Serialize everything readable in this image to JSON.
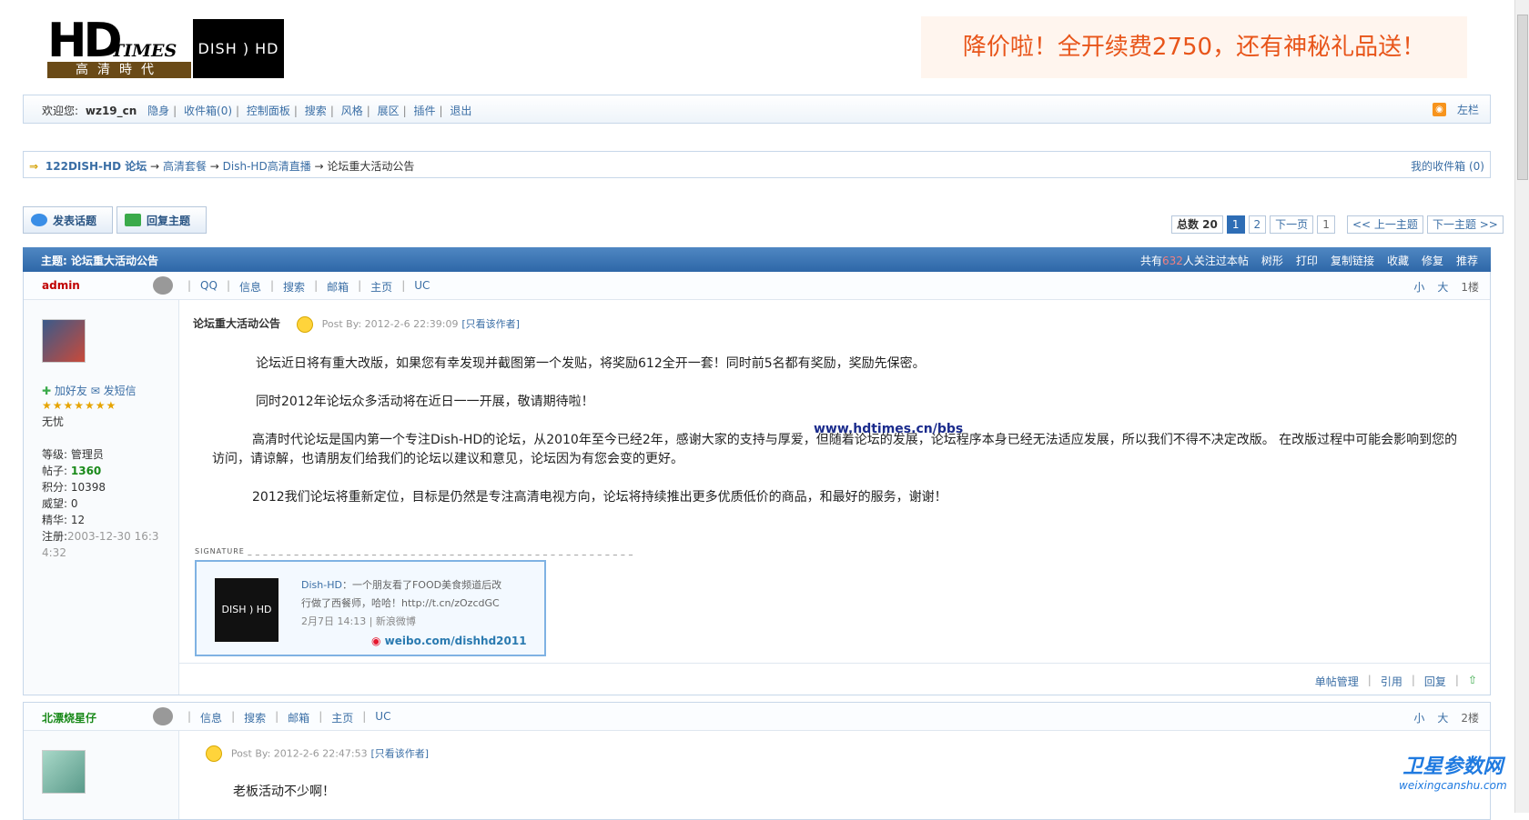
{
  "header": {
    "logo_hd": "HD",
    "logo_times": "TIMES",
    "logo_cn": "高清時代",
    "logo_dish": "DISH ) HD",
    "promo": "降价啦！全开续费2750，还有神秘礼品送！"
  },
  "userbar": {
    "welcome": "欢迎您:",
    "username": "wz19_cn",
    "links": [
      "隐身",
      "收件箱(0)",
      "控制面板",
      "搜索",
      "风格",
      "展区",
      "插件",
      "退出"
    ],
    "right_label": "左栏"
  },
  "breadcrumb": {
    "items": [
      "122DISH-HD 论坛",
      "高清套餐",
      "Dish-HD高清直播",
      "论坛重大活动公告"
    ],
    "separator": "→",
    "right": "我的收件箱 (0)"
  },
  "actions": {
    "new_topic": "发表话题",
    "reply": "回复主题"
  },
  "pager": {
    "total": "总数 20",
    "pages": [
      "1",
      "2"
    ],
    "next": "下一页",
    "jump": "1",
    "prev_topic": "<< 上一主题",
    "next_topic": "下一主题 >>"
  },
  "thread": {
    "title_label": "主题: 论坛重大活动公告",
    "watchers_prefix": "共有",
    "watchers_count": "632",
    "watchers_suffix": "人关注过本帖",
    "tools": [
      "树形",
      "打印",
      "复制链接",
      "收藏",
      "修复",
      "推荐"
    ]
  },
  "post1": {
    "author": "admin",
    "links": [
      "QQ",
      "信息",
      "搜索",
      "邮箱",
      "主页",
      "UC"
    ],
    "font_small": "小",
    "font_big": "大",
    "floor": "1楼",
    "add_friend": "加好友",
    "send_msg": "发短信",
    "stars": "★★★★★★★",
    "status": "无忧",
    "info": {
      "level": "等级: 管理员",
      "posts_label": "帖子:",
      "posts": "1360",
      "points": "积分: 10398",
      "prestige": "威望: 0",
      "essence": "精华: 12",
      "reg_label": "注册:",
      "reg": "2003-12-30 16:34:32"
    },
    "title": "论坛重大活动公告",
    "post_by": "Post By: 2012-2-6 22:39:09",
    "only_author": "[只看该作者]",
    "paragraphs": [
      "论坛近日将有重大改版，如果您有幸发现并截图第一个发贴，将奖励612全开一套！同时前5名都有奖励，奖励先保密。",
      "同时2012年论坛众多活动将在近日一一开展，敬请期待啦！",
      "高清时代论坛是国内第一个专注Dish-HD的论坛，从2010年至今已经2年，感谢大家的支持与厚爱，但随着论坛的发展，论坛程序本身已经无法适应发展，所以我们不得不决定改版。 在改版过程中可能会影响到您的",
      "访问，请谅解，也请朋友们给我们的论坛以建议和意见，论坛因为有您会变的更好。",
      "2012我们论坛将重新定位，目标是仍然是专注高清电视方向，论坛将持续推出更多优质低价的商品，和最好的服务，谢谢！"
    ],
    "overlay_url": "www.hdtimes.cn/bbs",
    "signature_label": "SIGNATURE",
    "sig": {
      "logo": "DISH ) HD",
      "name": "Dish-HD",
      "text1": "：一个朋友看了FOOD美食频道后改",
      "text2": "行做了西餐师，哈哈！http://t.cn/zOzcdGC",
      "meta": "2月7日 14:13 | 新浪微博",
      "weibo": "weibo.com/dishhd2011"
    },
    "footer": [
      "单帖管理",
      "引用",
      "回复"
    ]
  },
  "post2": {
    "author": "北漂烧星仔",
    "links": [
      "信息",
      "搜索",
      "邮箱",
      "主页",
      "UC"
    ],
    "font_small": "小",
    "font_big": "大",
    "floor": "2楼",
    "post_by": "Post By: 2012-2-6 22:47:53",
    "only_author": "[只看该作者]",
    "text": "老板活动不少啊！"
  },
  "watermark": {
    "title": "卫星参数网",
    "url": "weixingcanshu.com"
  },
  "colors": {
    "accent": "#2e67a8",
    "promo": "#e8551a",
    "link": "#3a6ea5"
  }
}
